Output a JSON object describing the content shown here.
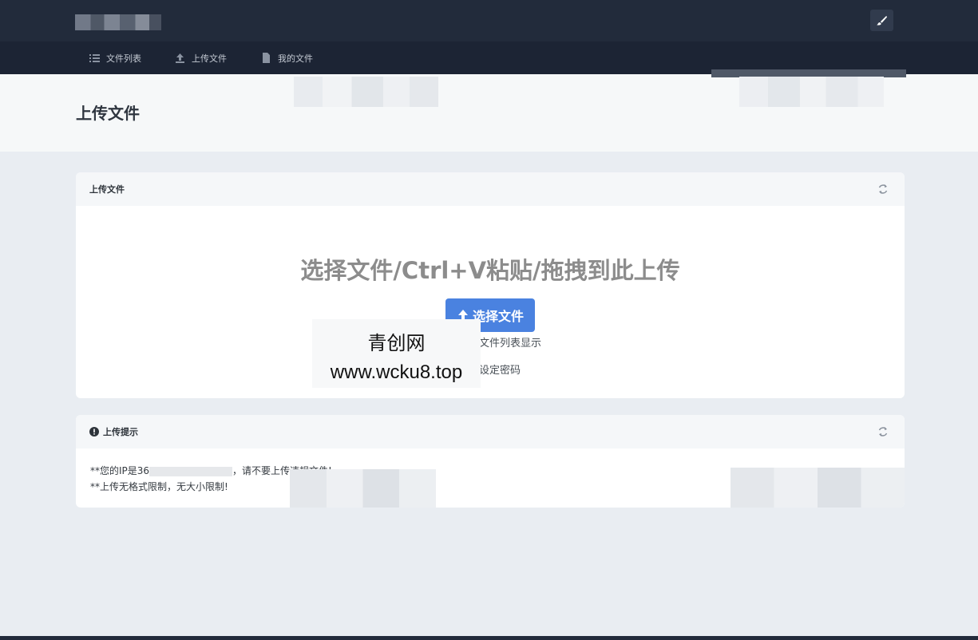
{
  "nav": {
    "items": [
      {
        "label": "文件列表",
        "icon": "list-icon"
      },
      {
        "label": "上传文件",
        "icon": "upload-icon"
      },
      {
        "label": "我的文件",
        "icon": "file-icon"
      }
    ]
  },
  "header": {
    "title": "上传文件"
  },
  "upload_card": {
    "title": "上传文件",
    "drop_text": "选择文件/Ctrl+V粘贴/拖拽到此上传",
    "select_button": "选择文件",
    "option_list": "文件列表显示",
    "option_password": "设定密码"
  },
  "tips_card": {
    "title": "上传提示",
    "line1_prefix": "**您的IP是36",
    "line1_suffix": "，请不要上传违规文件!",
    "line2": "**上传无格式限制，无大小限制!"
  },
  "watermark": {
    "line1": "青创网",
    "line2": "www.wcku8.top"
  },
  "colors": {
    "topbar": "#222b3b",
    "navbar": "#1c2434",
    "primary": "#4a82e0"
  }
}
